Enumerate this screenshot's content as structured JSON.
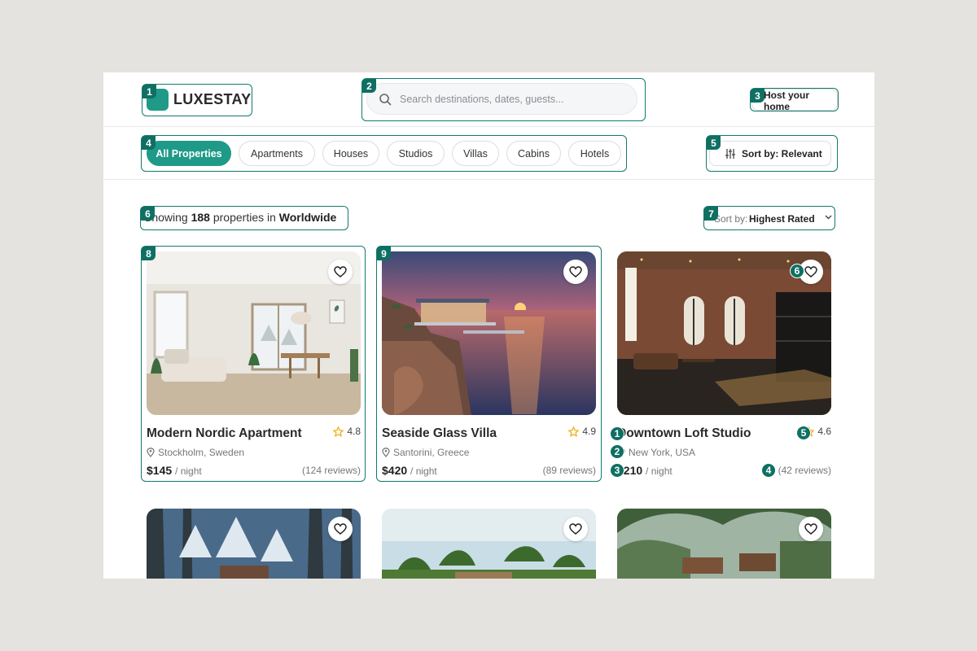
{
  "header": {
    "logo": "LUXESTAY",
    "search_placeholder": "Search destinations, dates, guests...",
    "host_button": "Host your home"
  },
  "filters": {
    "chips": [
      "All Properties",
      "Apartments",
      "Houses",
      "Studios",
      "Villas",
      "Cabins",
      "Hotels"
    ],
    "active": "All Properties",
    "sort_button": "Sort by: Relevant"
  },
  "results": {
    "prefix": "Showing",
    "count": "188",
    "middle": "properties in",
    "location": "Worldwide",
    "sort_prefix": "Sort by:",
    "sort_value": "Highest Rated"
  },
  "listings": [
    {
      "title": "Modern Nordic Apartment",
      "rating": "4.8",
      "location": "Stockholm, Sweden",
      "price": "$145",
      "unit": "/ night",
      "reviews": "(124 reviews)"
    },
    {
      "title": "Seaside Glass Villa",
      "rating": "4.9",
      "location": "Santorini, Greece",
      "price": "$420",
      "unit": "/ night",
      "reviews": "(89 reviews)"
    },
    {
      "title": "Downtown Loft Studio",
      "rating": "4.6",
      "location": "New York, USA",
      "price": "$210",
      "unit": "/ night",
      "reviews": "(42 reviews)"
    }
  ],
  "annotations": {
    "boxes": [
      "1",
      "2",
      "3",
      "4",
      "5",
      "6",
      "7",
      "8",
      "9"
    ],
    "card_markers": [
      "1",
      "2",
      "3",
      "4",
      "5",
      "6"
    ]
  },
  "colors": {
    "accent": "#1f9a88",
    "annotation": "#0f6f63",
    "star": "#f2b01e"
  },
  "icons": [
    "logo-mark",
    "search-icon",
    "sliders-icon",
    "chevron-down-icon",
    "heart-icon",
    "star-icon",
    "location-pin-icon"
  ]
}
